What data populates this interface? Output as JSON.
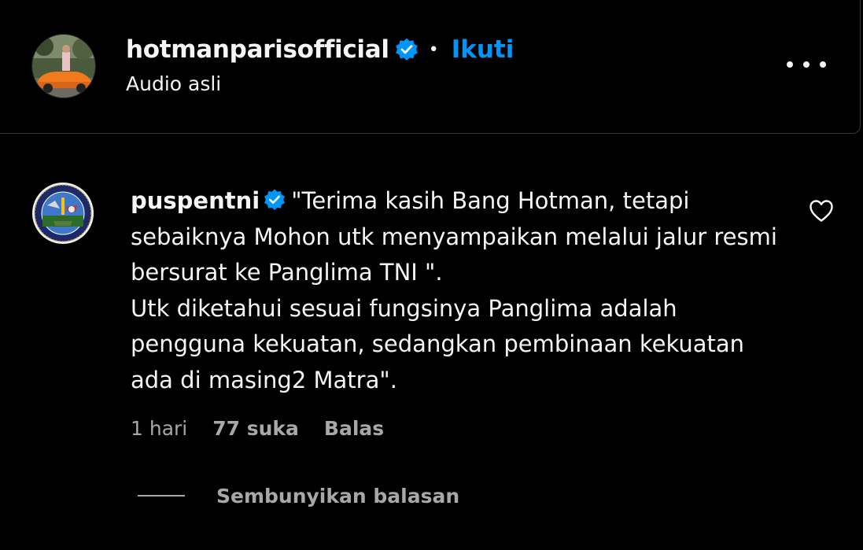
{
  "post": {
    "username": "hotmanparisofficial",
    "separator": "•",
    "follow_label": "Ikuti",
    "audio_label": "Audio asli",
    "avatar_icon": "profile-photo-orange-car",
    "more_icon": "more-horizontal-icon"
  },
  "comment": {
    "username": "puspentni",
    "text": "\"Terima kasih Bang Hotman, tetapi sebaiknya Mohon utk menyampaikan melalui jalur resmi bersurat ke Panglima TNI \".\nUtk diketahui sesuai fungsinya Panglima adalah pengguna kekuatan, sedangkan pembinaan kekuatan ada di masing2 Matra\".",
    "time": "1 hari",
    "likes": "77 suka",
    "reply_label": "Balas",
    "hide_replies_label": "Sembunyikan balasan",
    "avatar_icon": "military-emblem-logo",
    "like_icon": "heart-outline-icon"
  },
  "colors": {
    "background": "#000000",
    "text": "#f5f5f5",
    "secondary": "#a8a8a8",
    "link_blue": "#0095f6",
    "verified_blue": "#0095f6",
    "divider": "#363636"
  }
}
